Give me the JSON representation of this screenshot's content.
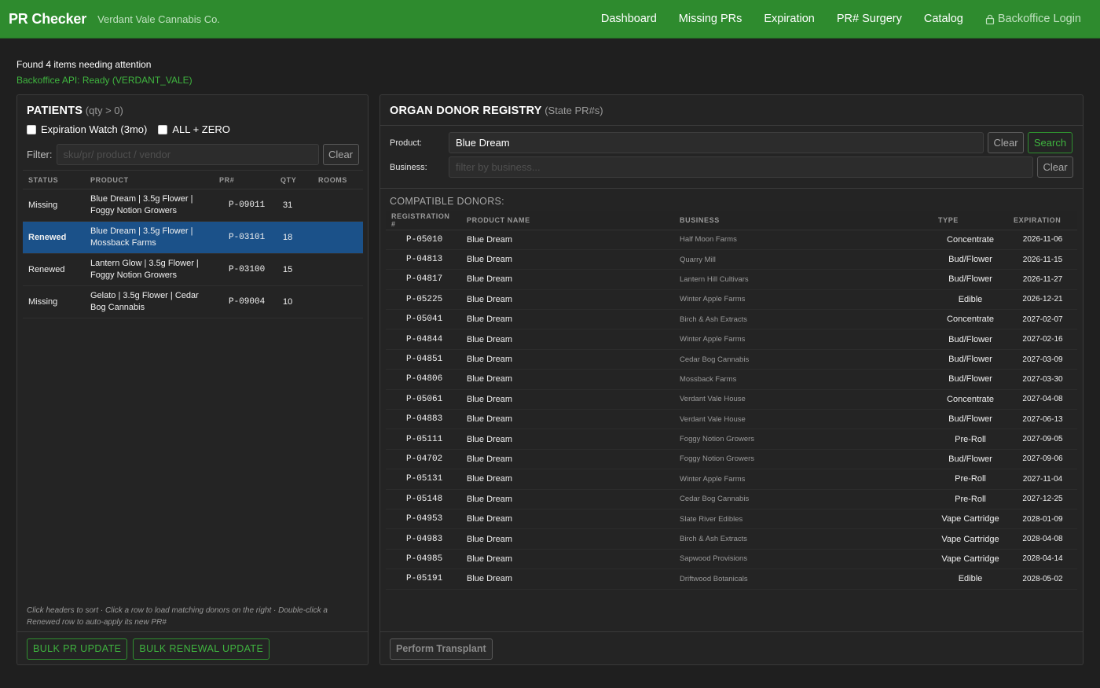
{
  "header": {
    "brand": "PR Checker",
    "company": "Verdant Vale Cannabis Co.",
    "nav": [
      "Dashboard",
      "Missing PRs",
      "Expiration",
      "PR# Surgery",
      "Catalog"
    ],
    "login_label": "Backoffice Login",
    "login_icon": "lock-icon"
  },
  "status": {
    "message": "Found 4 items needing attention",
    "api": "Backoffice API: Ready (VERDANT_VALE)"
  },
  "patients": {
    "title": "PATIENTS",
    "subtitle": "(qty > 0)",
    "checkbox_expiration": "Expiration Watch (3mo)",
    "checkbox_all_zero": "ALL + ZERO",
    "filter_label": "Filter:",
    "filter_placeholder": "sku/pr/ product / vendor",
    "filter_value": "",
    "clear_label": "Clear",
    "columns": [
      "STATUS",
      "PRODUCT",
      "PR#",
      "QTY",
      "ROOMS"
    ],
    "rows": [
      {
        "status": "Missing",
        "product": "Blue Dream | 3.5g Flower | Foggy Notion Growers",
        "pr": "P-09011",
        "qty": "31",
        "rooms": ""
      },
      {
        "status": "Renewed",
        "product": "Blue Dream | 3.5g Flower | Mossback Farms",
        "pr": "P-03101",
        "qty": "18",
        "rooms": ""
      },
      {
        "status": "Renewed",
        "product": "Lantern Glow | 3.5g Flower | Foggy Notion Growers",
        "pr": "P-03100",
        "qty": "15",
        "rooms": ""
      },
      {
        "status": "Missing",
        "product": "Gelato | 3.5g Flower | Cedar Bog Cannabis",
        "pr": "P-09004",
        "qty": "10",
        "rooms": ""
      }
    ],
    "selected_row": 1,
    "hint": "Click headers to sort · Click a row to load matching donors on the right · Double-click a Renewed row to auto-apply its new PR#",
    "bulk_pr_label": "BULK PR UPDATE",
    "bulk_renewal_label": "BULK RENEWAL UPDATE",
    "colors": {
      "missing": "#e0443a",
      "renewed": "#2f8ee8",
      "selected_bg": "#1b5189"
    }
  },
  "registry": {
    "title": "ORGAN DONOR REGISTRY",
    "subtitle": "(State PR#s)",
    "product_label": "Product:",
    "product_value": "Blue Dream",
    "business_label": "Business:",
    "business_placeholder": "filter by business...",
    "business_value": "",
    "clear_label": "Clear",
    "search_label": "Search",
    "donors_title": "COMPATIBLE DONORS:",
    "columns": [
      "REGISTRATION #",
      "PRODUCT NAME",
      "BUSINESS",
      "TYPE",
      "EXPIRATION"
    ],
    "rows": [
      {
        "reg": "P-05010",
        "name": "Blue Dream",
        "business": "Half Moon Farms",
        "type": "Concentrate",
        "exp": "2026-11-06"
      },
      {
        "reg": "P-04813",
        "name": "Blue Dream",
        "business": "Quarry Mill",
        "type": "Bud/Flower",
        "exp": "2026-11-15"
      },
      {
        "reg": "P-04817",
        "name": "Blue Dream",
        "business": "Lantern Hill Cultivars",
        "type": "Bud/Flower",
        "exp": "2026-11-27"
      },
      {
        "reg": "P-05225",
        "name": "Blue Dream",
        "business": "Winter Apple Farms",
        "type": "Edible",
        "exp": "2026-12-21"
      },
      {
        "reg": "P-05041",
        "name": "Blue Dream",
        "business": "Birch & Ash Extracts",
        "type": "Concentrate",
        "exp": "2027-02-07"
      },
      {
        "reg": "P-04844",
        "name": "Blue Dream",
        "business": "Winter Apple Farms",
        "type": "Bud/Flower",
        "exp": "2027-02-16"
      },
      {
        "reg": "P-04851",
        "name": "Blue Dream",
        "business": "Cedar Bog Cannabis",
        "type": "Bud/Flower",
        "exp": "2027-03-09"
      },
      {
        "reg": "P-04806",
        "name": "Blue Dream",
        "business": "Mossback Farms",
        "type": "Bud/Flower",
        "exp": "2027-03-30"
      },
      {
        "reg": "P-05061",
        "name": "Blue Dream",
        "business": "Verdant Vale House",
        "type": "Concentrate",
        "exp": "2027-04-08"
      },
      {
        "reg": "P-04883",
        "name": "Blue Dream",
        "business": "Verdant Vale House",
        "type": "Bud/Flower",
        "exp": "2027-06-13"
      },
      {
        "reg": "P-05111",
        "name": "Blue Dream",
        "business": "Foggy Notion Growers",
        "type": "Pre-Roll",
        "exp": "2027-09-05"
      },
      {
        "reg": "P-04702",
        "name": "Blue Dream",
        "business": "Foggy Notion Growers",
        "type": "Bud/Flower",
        "exp": "2027-09-06"
      },
      {
        "reg": "P-05131",
        "name": "Blue Dream",
        "business": "Winter Apple Farms",
        "type": "Pre-Roll",
        "exp": "2027-11-04"
      },
      {
        "reg": "P-05148",
        "name": "Blue Dream",
        "business": "Cedar Bog Cannabis",
        "type": "Pre-Roll",
        "exp": "2027-12-25"
      },
      {
        "reg": "P-04953",
        "name": "Blue Dream",
        "business": "Slate River Edibles",
        "type": "Vape Cartridge",
        "exp": "2028-01-09"
      },
      {
        "reg": "P-04983",
        "name": "Blue Dream",
        "business": "Birch & Ash Extracts",
        "type": "Vape Cartridge",
        "exp": "2028-04-08"
      },
      {
        "reg": "P-04985",
        "name": "Blue Dream",
        "business": "Sapwood Provisions",
        "type": "Vape Cartridge",
        "exp": "2028-04-14"
      },
      {
        "reg": "P-05191",
        "name": "Blue Dream",
        "business": "Driftwood Botanicals",
        "type": "Edible",
        "exp": "2028-05-02"
      }
    ],
    "transplant_label": "Perform Transplant"
  },
  "theme": {
    "brand_green": "#2e8b2e",
    "api_green": "#3fb43f",
    "background": "#1f1f1f"
  }
}
